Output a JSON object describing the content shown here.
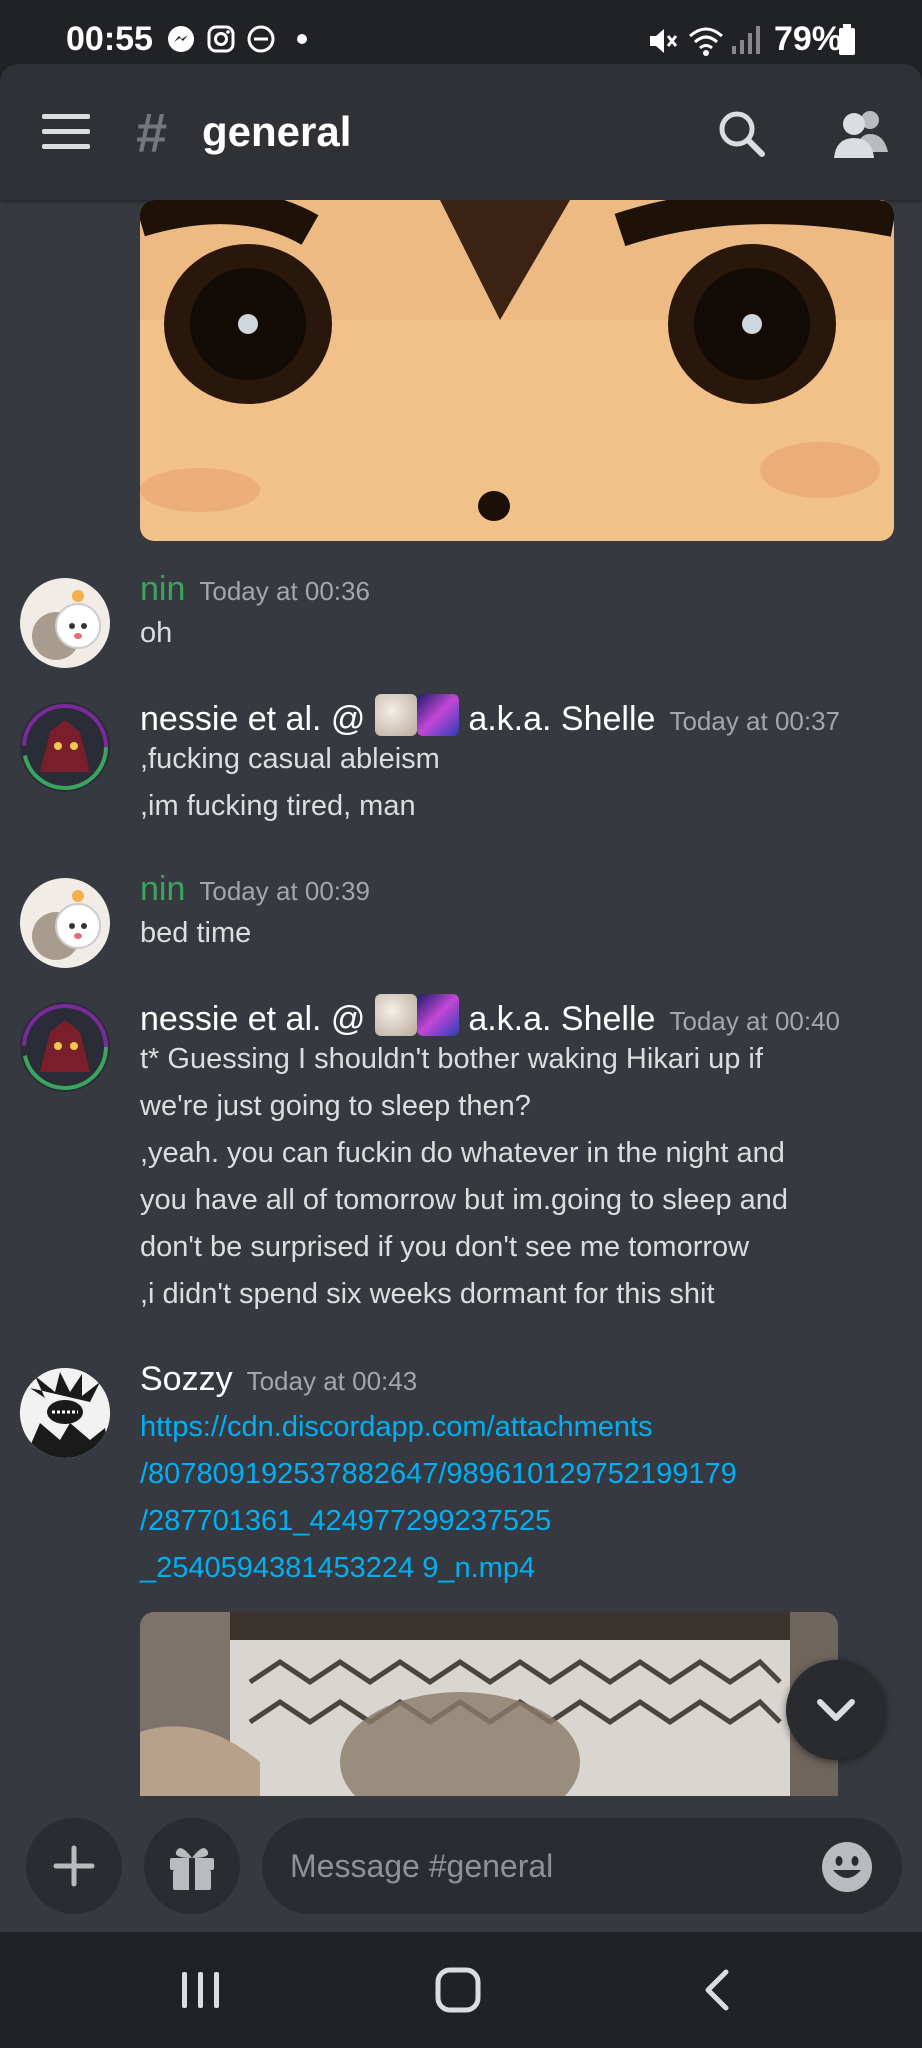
{
  "status_bar": {
    "time": "00:55",
    "battery": "79%",
    "left_icons": [
      "messenger-icon",
      "instagram-icon",
      "do-not-disturb-icon",
      "dot-icon"
    ],
    "right_icons": [
      "mute-icon",
      "wifi-icon",
      "signal-icon",
      "battery-icon"
    ]
  },
  "header": {
    "hash": "#",
    "channel_name": "general"
  },
  "messages": [
    {
      "author": "nin",
      "timestamp": "Today at 00:36",
      "lines": [
        "oh"
      ]
    },
    {
      "author_prefix": "nessie et al. @",
      "author_suffix": "a.k.a. Shelle",
      "timestamp": "Today at 00:37",
      "lines": [
        ",fucking casual ableism",
        ",im fucking tired, man"
      ]
    },
    {
      "author": "nin",
      "timestamp": "Today at 00:39",
      "lines": [
        "bed time"
      ]
    },
    {
      "author_prefix": "nessie et al. @",
      "author_suffix": "a.k.a. Shelle",
      "timestamp": "Today at 00:40",
      "lines": [
        "t* Guessing I shouldn't bother waking Hikari up if",
        "we're just going to sleep then?",
        ",yeah. you can fuckin do whatever in the night and",
        "you have all of tomorrow but im.going to sleep and",
        "don't be surprised if you don't see me tomorrow",
        ",i didn't spend six weeks dormant for this shit"
      ]
    },
    {
      "author": "Sozzy",
      "timestamp": "Today at 00:43",
      "link_lines": [
        "https://cdn.discordapp.com/attachments",
        "/807809192537882647/989610129752199179",
        "/287701361_424977299237525",
        "_2540594381453224 9_n.mp4"
      ]
    }
  ],
  "composer": {
    "placeholder": "Message #general"
  },
  "colors": {
    "background": "#36393f",
    "header": "#2f3136",
    "system_bar": "#202225",
    "username_green": "#3ba55d",
    "link": "#00aff4"
  }
}
